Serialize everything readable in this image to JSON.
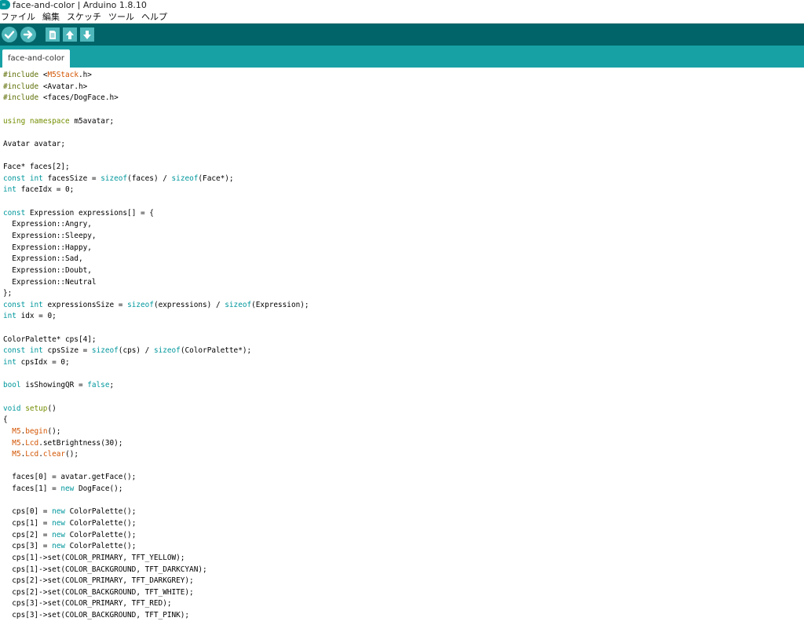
{
  "window": {
    "title": "face-and-color | Arduino 1.8.10",
    "logo_text": "∞"
  },
  "menu": [
    {
      "label": "ファイル"
    },
    {
      "label": "編集"
    },
    {
      "label": "スケッチ"
    },
    {
      "label": "ツール"
    },
    {
      "label": "ヘルプ"
    }
  ],
  "toolbar": {
    "buttons": [
      {
        "name": "verify",
        "icon": "check-icon"
      },
      {
        "name": "upload",
        "icon": "arrow-right-icon"
      },
      {
        "name": "new",
        "icon": "file-icon"
      },
      {
        "name": "open",
        "icon": "arrow-up-icon"
      },
      {
        "name": "save",
        "icon": "arrow-down-icon"
      }
    ]
  },
  "tabs": [
    {
      "label": "face-and-color",
      "active": true
    }
  ],
  "colors": {
    "toolbar_bg": "#006468",
    "tabbar_bg": "#17a1a5",
    "button_bg": "#4db7bb",
    "preprocessor": "#5e6d03",
    "keyword": "#00979c",
    "function": "#d35400"
  },
  "code": [
    [
      [
        "pre",
        "#include "
      ],
      [
        "txt",
        "<"
      ],
      [
        "lib",
        "M5Stack"
      ],
      [
        "txt",
        ".h>"
      ]
    ],
    [
      [
        "pre",
        "#include "
      ],
      [
        "txt",
        "<Avatar.h>"
      ]
    ],
    [
      [
        "pre",
        "#include "
      ],
      [
        "txt",
        "<faces/DogFace.h>"
      ]
    ],
    [],
    [
      [
        "kw2",
        "using"
      ],
      [
        "txt",
        " "
      ],
      [
        "kw2",
        "namespace"
      ],
      [
        "txt",
        " m5avatar;"
      ]
    ],
    [],
    [
      [
        "txt",
        "Avatar avatar;"
      ]
    ],
    [],
    [
      [
        "txt",
        "Face* faces[2];"
      ]
    ],
    [
      [
        "type",
        "const"
      ],
      [
        "txt",
        " "
      ],
      [
        "type",
        "int"
      ],
      [
        "txt",
        " facesSize = "
      ],
      [
        "kw",
        "sizeof"
      ],
      [
        "txt",
        "(faces) / "
      ],
      [
        "kw",
        "sizeof"
      ],
      [
        "txt",
        "(Face*);"
      ]
    ],
    [
      [
        "type",
        "int"
      ],
      [
        "txt",
        " faceIdx = 0;"
      ]
    ],
    [],
    [
      [
        "type",
        "const"
      ],
      [
        "txt",
        " Expression expressions[] = {"
      ]
    ],
    [
      [
        "txt",
        "  Expression::Angry,"
      ]
    ],
    [
      [
        "txt",
        "  Expression::Sleepy,"
      ]
    ],
    [
      [
        "txt",
        "  Expression::Happy,"
      ]
    ],
    [
      [
        "txt",
        "  Expression::Sad,"
      ]
    ],
    [
      [
        "txt",
        "  Expression::Doubt,"
      ]
    ],
    [
      [
        "txt",
        "  Expression::Neutral"
      ]
    ],
    [
      [
        "txt",
        "};"
      ]
    ],
    [
      [
        "type",
        "const"
      ],
      [
        "txt",
        " "
      ],
      [
        "type",
        "int"
      ],
      [
        "txt",
        " expressionsSize = "
      ],
      [
        "kw",
        "sizeof"
      ],
      [
        "txt",
        "(expressions) / "
      ],
      [
        "kw",
        "sizeof"
      ],
      [
        "txt",
        "(Expression);"
      ]
    ],
    [
      [
        "type",
        "int"
      ],
      [
        "txt",
        " idx = 0;"
      ]
    ],
    [],
    [
      [
        "txt",
        "ColorPalette* cps[4];"
      ]
    ],
    [
      [
        "type",
        "const"
      ],
      [
        "txt",
        " "
      ],
      [
        "type",
        "int"
      ],
      [
        "txt",
        " cpsSize = "
      ],
      [
        "kw",
        "sizeof"
      ],
      [
        "txt",
        "(cps) / "
      ],
      [
        "kw",
        "sizeof"
      ],
      [
        "txt",
        "(ColorPalette*);"
      ]
    ],
    [
      [
        "type",
        "int"
      ],
      [
        "txt",
        " cpsIdx = 0;"
      ]
    ],
    [],
    [
      [
        "type",
        "bool"
      ],
      [
        "txt",
        " isShowingQR = "
      ],
      [
        "lit",
        "false"
      ],
      [
        "txt",
        ";"
      ]
    ],
    [],
    [
      [
        "type",
        "void"
      ],
      [
        "txt",
        " "
      ],
      [
        "kw2",
        "setup"
      ],
      [
        "txt",
        "()"
      ]
    ],
    [
      [
        "txt",
        "{"
      ]
    ],
    [
      [
        "txt",
        "  "
      ],
      [
        "m5",
        "M5"
      ],
      [
        "txt",
        "."
      ],
      [
        "fn",
        "begin"
      ],
      [
        "txt",
        "();"
      ]
    ],
    [
      [
        "txt",
        "  "
      ],
      [
        "m5",
        "M5"
      ],
      [
        "txt",
        "."
      ],
      [
        "m5",
        "Lcd"
      ],
      [
        "txt",
        ".setBrightness(30);"
      ]
    ],
    [
      [
        "txt",
        "  "
      ],
      [
        "m5",
        "M5"
      ],
      [
        "txt",
        "."
      ],
      [
        "m5",
        "Lcd"
      ],
      [
        "txt",
        "."
      ],
      [
        "fn",
        "clear"
      ],
      [
        "txt",
        "();"
      ]
    ],
    [],
    [
      [
        "txt",
        "  faces[0] = avatar.getFace();"
      ]
    ],
    [
      [
        "txt",
        "  faces[1] = "
      ],
      [
        "kw",
        "new"
      ],
      [
        "txt",
        " DogFace();"
      ]
    ],
    [],
    [
      [
        "txt",
        "  cps[0] = "
      ],
      [
        "kw",
        "new"
      ],
      [
        "txt",
        " ColorPalette();"
      ]
    ],
    [
      [
        "txt",
        "  cps[1] = "
      ],
      [
        "kw",
        "new"
      ],
      [
        "txt",
        " ColorPalette();"
      ]
    ],
    [
      [
        "txt",
        "  cps[2] = "
      ],
      [
        "kw",
        "new"
      ],
      [
        "txt",
        " ColorPalette();"
      ]
    ],
    [
      [
        "txt",
        "  cps[3] = "
      ],
      [
        "kw",
        "new"
      ],
      [
        "txt",
        " ColorPalette();"
      ]
    ],
    [
      [
        "txt",
        "  cps[1]->set(COLOR_PRIMARY, TFT_YELLOW);"
      ]
    ],
    [
      [
        "txt",
        "  cps[1]->set(COLOR_BACKGROUND, TFT_DARKCYAN);"
      ]
    ],
    [
      [
        "txt",
        "  cps[2]->set(COLOR_PRIMARY, TFT_DARKGREY);"
      ]
    ],
    [
      [
        "txt",
        "  cps[2]->set(COLOR_BACKGROUND, TFT_WHITE);"
      ]
    ],
    [
      [
        "txt",
        "  cps[3]->set(COLOR_PRIMARY, TFT_RED);"
      ]
    ],
    [
      [
        "txt",
        "  cps[3]->set(COLOR_BACKGROUND, TFT_PINK);"
      ]
    ]
  ]
}
